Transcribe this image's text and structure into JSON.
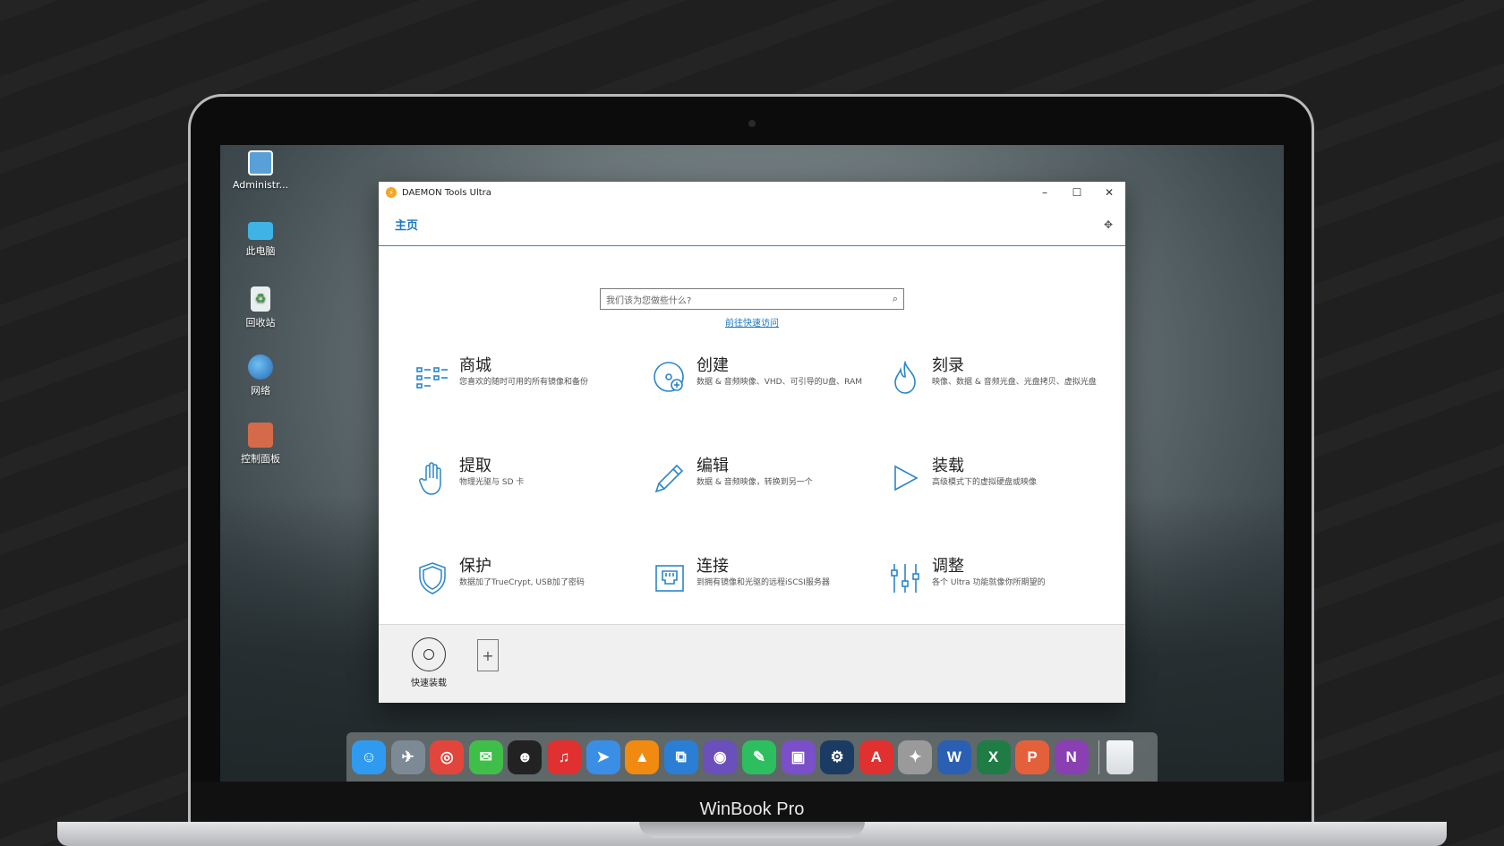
{
  "device": {
    "brand_label": "WinBook Pro"
  },
  "desktop": {
    "icons": [
      {
        "label": "Administr...",
        "icon": "user-folder-icon",
        "color": "#5aa0d8"
      },
      {
        "label": "此电脑",
        "icon": "computer-icon",
        "color": "#3fb3e6"
      },
      {
        "label": "回收站",
        "icon": "recycle-bin-icon",
        "color": "#e9eef0"
      },
      {
        "label": "网络",
        "icon": "network-globe-icon",
        "color": "#3d8fd6"
      },
      {
        "label": "控制面板",
        "icon": "control-panel-icon",
        "color": "#d46a4a"
      }
    ]
  },
  "app": {
    "title": "DAEMON Tools Ultra",
    "controls": {
      "minimize": "–",
      "maximize": "☐",
      "close": "✕"
    },
    "tab_home": "主页",
    "pin_icon": "✥",
    "search": {
      "placeholder": "我们该为您做些什么?",
      "icon": "⌕"
    },
    "quick_access_link": "前往快速访问",
    "tiles": [
      {
        "title": "商城",
        "desc": "您喜欢的随时可用的所有镜像和备份",
        "icon": "catalog-icon"
      },
      {
        "title": "创建",
        "desc": "数据 & 音频映像、VHD、可引导的U盘、RAM",
        "icon": "create-disc-icon"
      },
      {
        "title": "刻录",
        "desc": "映像、数据 & 音频光盘、光盘拷贝、虚拟光盘",
        "icon": "burn-flame-icon"
      },
      {
        "title": "提取",
        "desc": "物理光驱与 SD 卡",
        "icon": "grab-hand-icon"
      },
      {
        "title": "编辑",
        "desc": "数据 & 音频映像，转换到另一个",
        "icon": "edit-pencil-icon"
      },
      {
        "title": "装载",
        "desc": "高级模式下的虚拟硬盘或映像",
        "icon": "mount-play-icon"
      },
      {
        "title": "保护",
        "desc": "数据加了TrueCrypt, USB加了密码",
        "icon": "protect-shield-icon"
      },
      {
        "title": "连接",
        "desc": "到拥有镜像和光驱的远程iSCSI服务器",
        "icon": "connect-network-icon"
      },
      {
        "title": "调整",
        "desc": "各个 Ultra 功能就像你所期望的",
        "icon": "sliders-icon"
      }
    ],
    "bottom": {
      "quick_mount_label": "快速装载",
      "add_icon": "+"
    }
  },
  "dock": {
    "items": [
      {
        "name": "finder-icon",
        "color": "#2f9bf0",
        "glyph": "☺"
      },
      {
        "name": "launchpad-icon",
        "color": "#7d8a96",
        "glyph": "✈"
      },
      {
        "name": "chrome-icon",
        "color": "#e2453c",
        "glyph": "◎"
      },
      {
        "name": "wechat-icon",
        "color": "#3fbf4a",
        "glyph": "✉"
      },
      {
        "name": "qq-icon",
        "color": "#222222",
        "glyph": "☻"
      },
      {
        "name": "netease-music-icon",
        "color": "#e0302f",
        "glyph": "♫"
      },
      {
        "name": "feishu-icon",
        "color": "#3a8ee6",
        "glyph": "➤"
      },
      {
        "name": "vlc-icon",
        "color": "#f08a10",
        "glyph": "▲"
      },
      {
        "name": "vscode-icon",
        "color": "#2a7fd4",
        "glyph": "⧉"
      },
      {
        "name": "github-icon",
        "color": "#6b4fbb",
        "glyph": "◉"
      },
      {
        "name": "evernote-icon",
        "color": "#2dbe60",
        "glyph": "✎"
      },
      {
        "name": "twitch-icon",
        "color": "#7a4fc9",
        "glyph": "▣"
      },
      {
        "name": "steam-icon",
        "color": "#1b3b63",
        "glyph": "⚙"
      },
      {
        "name": "acrobat-icon",
        "color": "#e0302f",
        "glyph": "A"
      },
      {
        "name": "inkscape-icon",
        "color": "#9a9a9a",
        "glyph": "✦"
      },
      {
        "name": "word-icon",
        "color": "#2b5fb4",
        "glyph": "W"
      },
      {
        "name": "excel-icon",
        "color": "#1f7c45",
        "glyph": "X"
      },
      {
        "name": "powerpoint-icon",
        "color": "#e4603b",
        "glyph": "P"
      },
      {
        "name": "onenote-icon",
        "color": "#8a3fb3",
        "glyph": "N"
      }
    ],
    "trash": {
      "name": "trash-icon",
      "color": "#d9dde0",
      "glyph": ""
    }
  }
}
